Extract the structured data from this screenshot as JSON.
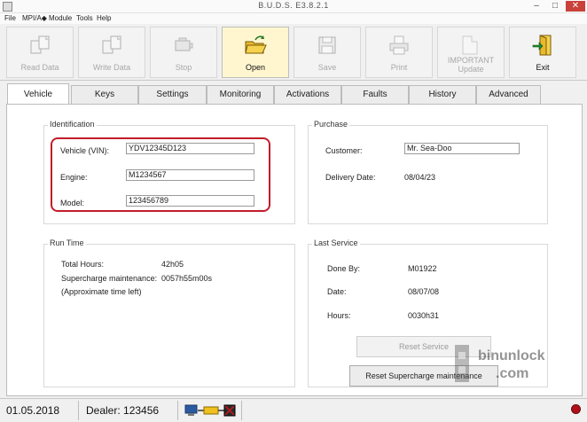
{
  "window": {
    "title": "B.U.D.S. E3.8.2.1",
    "controls": [
      "–",
      "□",
      "✕"
    ]
  },
  "menu": [
    "File",
    "MPI/A◆",
    "Module",
    "Tools",
    "Help"
  ],
  "toolbar": [
    {
      "label": "Read Data",
      "icon": "read-data-icon",
      "enabled": false
    },
    {
      "label": "Write Data",
      "icon": "write-data-icon",
      "enabled": false
    },
    {
      "label": "Stop",
      "icon": "stop-engine-icon",
      "enabled": false
    },
    {
      "label": "Open",
      "icon": "open-folder-icon",
      "enabled": true,
      "active": true
    },
    {
      "label": "Save",
      "icon": "save-disk-icon",
      "enabled": false
    },
    {
      "label": "Print",
      "icon": "printer-icon",
      "enabled": false
    },
    {
      "label": "IMPORTANT Update",
      "icon": "update-icon",
      "enabled": false
    },
    {
      "label": "Exit",
      "icon": "exit-door-icon",
      "enabled": true
    }
  ],
  "tabs": [
    "Vehicle",
    "Keys",
    "Settings",
    "Monitoring",
    "Activations",
    "Faults",
    "History",
    "Advanced"
  ],
  "active_tab": "Vehicle",
  "identification": {
    "title": "Identification",
    "vin_label": "Vehicle (VIN):",
    "vin_value": "YDV12345D123",
    "engine_label": "Engine:",
    "engine_value": "M1234567",
    "model_label": "Model:",
    "model_value": "123456789"
  },
  "purchase": {
    "title": "Purchase",
    "customer_label": "Customer:",
    "customer_value": "Mr. Sea-Doo",
    "delivery_label": "Delivery Date:",
    "delivery_value": "08/04/23"
  },
  "runtime": {
    "title": "Run Time",
    "hours_label": "Total Hours:",
    "hours_value": "42h05",
    "supercharge_label": "Supercharge maintenance:",
    "supercharge_value": "0057h55m00s",
    "approx_label": "(Approximate time left)"
  },
  "last_service": {
    "title": "Last Service",
    "done_by_label": "Done By:",
    "done_by_value": "M01922",
    "date_label": "Date:",
    "date_value": "08/07/08",
    "hours_label": "Hours:",
    "hours_value": "0030h31",
    "reset_service": "Reset Service",
    "reset_supercharge": "Reset Supercharge maintenance"
  },
  "status": {
    "date": "01.05.2018",
    "dealer": "Dealer: 123456"
  },
  "watermark": {
    "line1": "binunlock",
    "line2": ".com"
  },
  "colors": {
    "highlight": "#c21d2a",
    "active_button": "#fff6cf",
    "status_led": "#b10f1a"
  }
}
